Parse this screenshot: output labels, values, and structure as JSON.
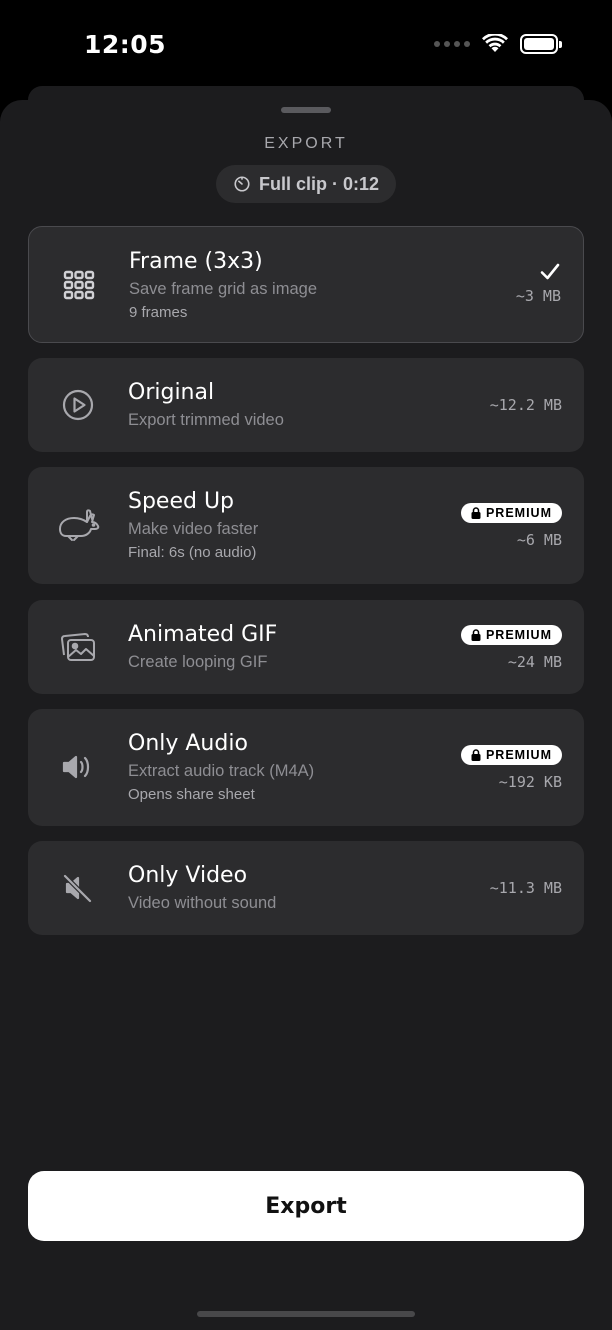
{
  "status_bar": {
    "time": "12:05"
  },
  "sheet": {
    "title": "EXPORT",
    "clip_label": "Full clip · 0:12"
  },
  "options": [
    {
      "title": "Frame (3x3)",
      "subtitle": "Save frame grid as image",
      "extra": "9 frames",
      "size": "~3 MB",
      "icon": "grid-icon",
      "selected": true,
      "premium": false
    },
    {
      "title": "Original",
      "subtitle": "Export trimmed video",
      "size": "~12.2 MB",
      "icon": "play-circle-icon",
      "selected": false,
      "premium": false
    },
    {
      "title": "Speed Up",
      "subtitle": "Make video faster",
      "extra": "Final: 6s (no audio)",
      "size": "~6 MB",
      "icon": "rabbit-icon",
      "selected": false,
      "premium": true,
      "badge": "PREMIUM"
    },
    {
      "title": "Animated GIF",
      "subtitle": "Create looping GIF",
      "size": "~24 MB",
      "icon": "photos-icon",
      "selected": false,
      "premium": true,
      "badge": "PREMIUM"
    },
    {
      "title": "Only Audio",
      "subtitle": "Extract audio track (M4A)",
      "extra": "Opens share sheet",
      "size": "~192 KB",
      "icon": "speaker-icon",
      "selected": false,
      "premium": true,
      "badge": "PREMIUM"
    },
    {
      "title": "Only Video",
      "subtitle": "Video without sound",
      "size": "~11.3 MB",
      "icon": "speaker-muted-icon",
      "selected": false,
      "premium": false
    }
  ],
  "export_button": {
    "label": "Export"
  },
  "colors": {
    "background": "#1c1c1e",
    "card": "#2c2c2e",
    "accent": "#ffffff"
  }
}
